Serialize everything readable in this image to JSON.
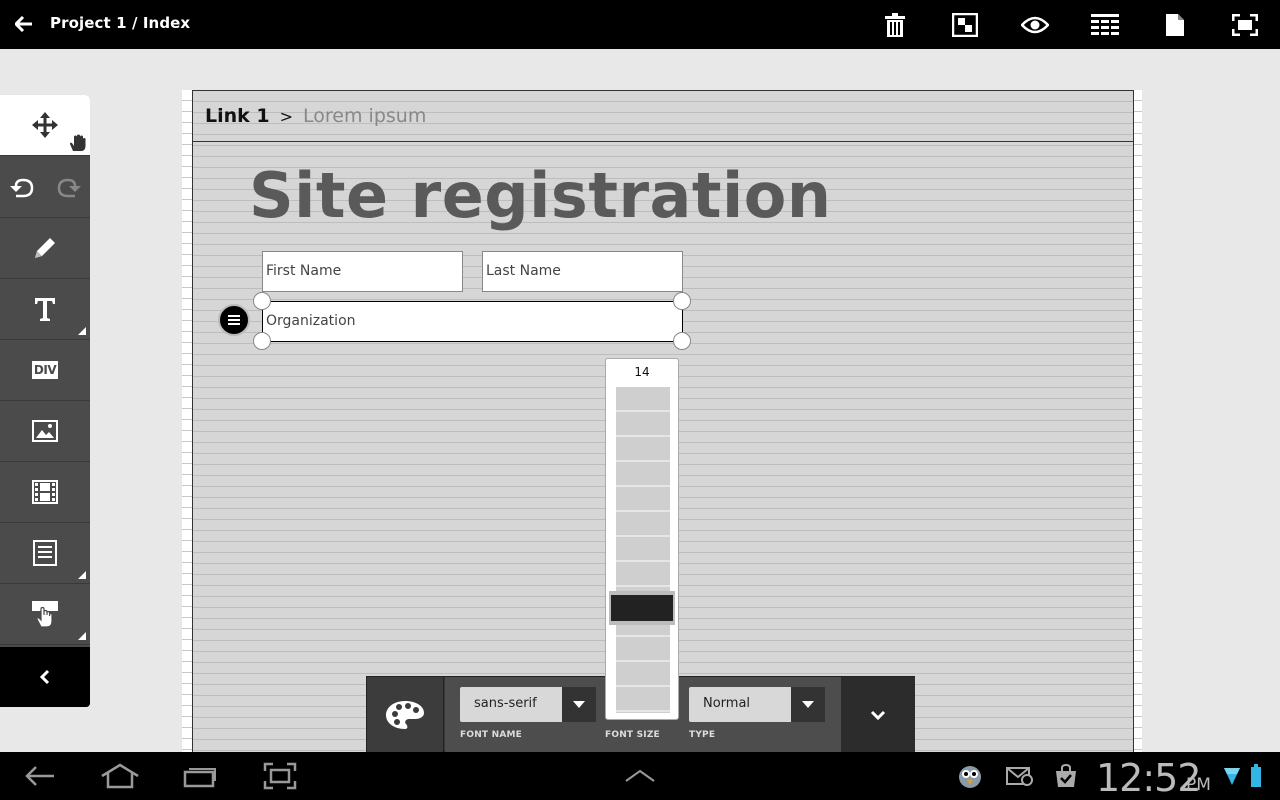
{
  "topbar": {
    "title": "Project 1 / Index",
    "tools": [
      "trash-icon",
      "layout-icon",
      "eye-icon",
      "grid-icon",
      "page-icon",
      "fullscreen-icon"
    ]
  },
  "palette": {
    "items": [
      "move-tool",
      "undo",
      "redo",
      "pencil-tool",
      "text-tool",
      "div-tool",
      "image-tool",
      "video-tool",
      "form-tool",
      "interaction-tool",
      "collapse"
    ],
    "div_label": "DIV"
  },
  "canvas": {
    "breadcrumb": {
      "link": "Link 1",
      "separator": ">",
      "current": "Lorem ipsum"
    },
    "title": "Site registration",
    "fields": {
      "first_name": "First Name",
      "last_name": "Last Name",
      "organization": "Organization"
    }
  },
  "format_toolbar": {
    "font_name": {
      "value": "sans-serif",
      "label": "FONT NAME"
    },
    "font_size": {
      "value": "14",
      "label": "FONT SIZE",
      "level": 0.3
    },
    "type": {
      "value": "Normal",
      "label": "TYPE"
    }
  },
  "statusbar": {
    "time": "12:52",
    "ampm": "PM"
  },
  "colors": {
    "topbar": "#000000",
    "palette": "#4b4b4b",
    "canvas": "#d6d6d6",
    "title": "#5a5a5a",
    "battery": "#33b5e5"
  }
}
